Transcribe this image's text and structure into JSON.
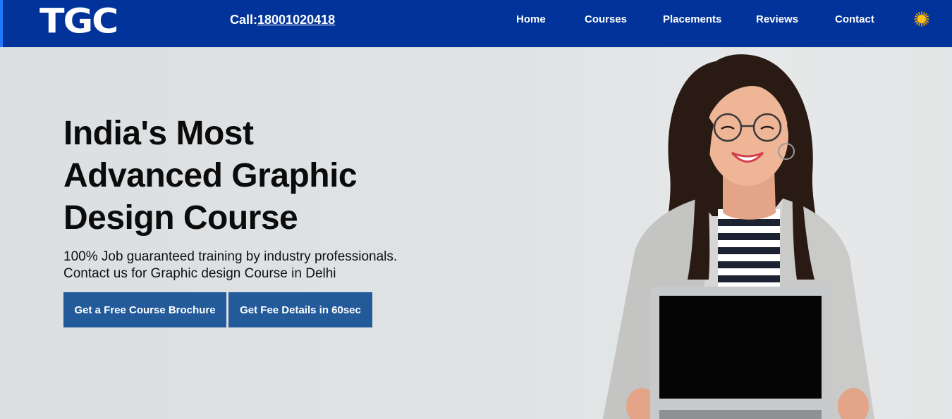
{
  "header": {
    "logo_text": "TGC",
    "call_label": "Call:",
    "call_number": "18001020418",
    "nav": [
      {
        "label": "Home"
      },
      {
        "label": "Courses"
      },
      {
        "label": "Placements"
      },
      {
        "label": "Reviews"
      },
      {
        "label": "Contact"
      }
    ],
    "theme_icon": "sun-icon"
  },
  "hero": {
    "headline": "India's Most Advanced Graphic Design Course",
    "subtext_line1": "100% Job guaranteed training by industry professionals.",
    "subtext_line2": "Contact us for Graphic design Course in Delhi",
    "buttons": {
      "brochure": "Get a Free Course Brochure",
      "fee": "Get Fee Details in 60sec"
    },
    "image_icon": "woman-with-laptop-photo"
  },
  "colors": {
    "nav_bg": "#01339a",
    "button_bg": "#235a9a",
    "hero_bg": "#dfe2e4"
  }
}
